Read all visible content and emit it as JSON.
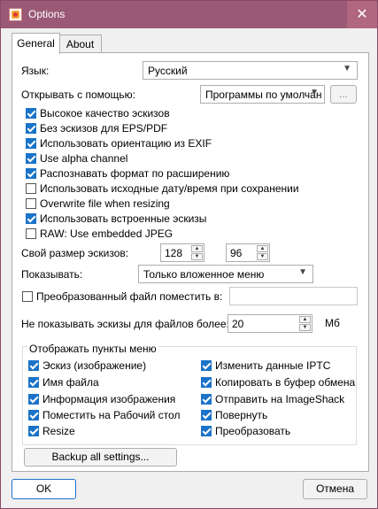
{
  "window": {
    "title": "Options",
    "close_glyph": "✕"
  },
  "tabs": [
    {
      "label": "General",
      "active": true
    },
    {
      "label": "About",
      "active": false
    }
  ],
  "general": {
    "language_label": "Язык:",
    "language_value": "Русский",
    "open_with_label": "Открывать с помощью:",
    "open_with_value": "Программы по умолчан",
    "browse_label": "...",
    "checkboxes": [
      {
        "label": "Высокое качество эскизов",
        "checked": true
      },
      {
        "label": "Без эскизов для EPS/PDF",
        "checked": true
      },
      {
        "label": "Использовать ориентацию из EXIF",
        "checked": true
      },
      {
        "label": "Use alpha channel",
        "checked": true
      },
      {
        "label": "Распознавать формат по расширению",
        "checked": true
      },
      {
        "label": "Использовать исходные дату/время при сохранении",
        "checked": false
      },
      {
        "label": "Overwrite file when resizing",
        "checked": false
      },
      {
        "label": "Использовать встроенные эскизы",
        "checked": true
      },
      {
        "label": "RAW: Use embedded JPEG",
        "checked": false
      }
    ],
    "thumb_size_label": "Свой размер эскизов:",
    "thumb_width": "128",
    "thumb_height": "96",
    "show_label": "Показывать:",
    "show_value": "Только вложенное меню",
    "converted_label": "Преобразованный файл поместить в:",
    "converted_checked": false,
    "converted_value": "",
    "max_size_label": "Не показывать эскизы для файлов более:",
    "max_size_value": "20",
    "max_size_unit": "Мб",
    "menu_group_title": "Отображать пункты меню",
    "menu_left": [
      {
        "label": "Эскиз (изображение)",
        "checked": true
      },
      {
        "label": "Имя файла",
        "checked": true
      },
      {
        "label": "Информация изображения",
        "checked": true
      },
      {
        "label": "Поместить на Рабочий стол",
        "checked": true
      },
      {
        "label": "Resize",
        "checked": true
      }
    ],
    "menu_right": [
      {
        "label": "Изменить данные IPTC",
        "checked": true
      },
      {
        "label": "Копировать в буфер обмена",
        "checked": true
      },
      {
        "label": "Отправить на ImageShack",
        "checked": true
      },
      {
        "label": "Повернуть",
        "checked": true
      },
      {
        "label": "Преобразовать",
        "checked": true
      }
    ],
    "backup_label": "Backup all settings..."
  },
  "footer": {
    "ok_label": "OK",
    "cancel_label": "Отмена"
  },
  "colors": {
    "titlebar": "#9a5a76",
    "accent": "#1a73c8"
  }
}
